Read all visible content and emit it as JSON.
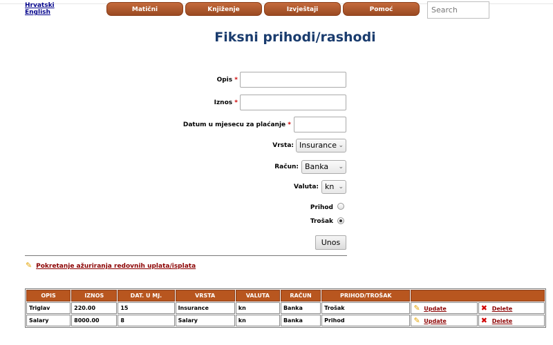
{
  "languages": [
    "Hrvatski",
    "English"
  ],
  "nav": [
    "Matični",
    "Knjiženje",
    "Izvještaji",
    "Pomoć"
  ],
  "search": {
    "placeholder": "Search"
  },
  "title": "Fiksni prihodi/rashodi",
  "form": {
    "opis_label": "Opis",
    "iznos_label": "Iznos",
    "datum_label": "Datum u mjesecu za plaćanje",
    "required_mark": "*",
    "vrsta_label": "Vrsta:",
    "vrsta_value": "Insurance",
    "racun_label": "Račun:",
    "racun_value": "Banka",
    "valuta_label": "Valuta:",
    "valuta_value": "kn",
    "prihod_label": "Prihod",
    "trosak_label": "Trošak",
    "selected_type": "Trošak",
    "submit_label": "Unos"
  },
  "update_link": "Pokretanje ažuriranja redovnih uplata/isplata",
  "table": {
    "headers": [
      "OPIS",
      "IZNOS",
      "DAT. U MJ.",
      "VRSTA",
      "VALUTA",
      "RAČUN",
      "PRIHOD/TROŠAK",
      ""
    ],
    "rows": [
      {
        "opis": "Triglav",
        "iznos": "220.00",
        "dan": "15",
        "vrsta": "Insurance",
        "valuta": "kn",
        "racun": "Banka",
        "tip": "Trošak",
        "update": "Update",
        "delete": "Delete"
      },
      {
        "opis": "Salary",
        "iznos": "8000.00",
        "dan": "8",
        "vrsta": "Salary",
        "valuta": "kn",
        "racun": "Banka",
        "tip": "Prihod",
        "update": "Update",
        "delete": "Delete"
      }
    ]
  },
  "colors": {
    "nav_button": "#b8561f",
    "title": "#1a3c6e",
    "link": "#8b0000",
    "required": "#cc0000"
  }
}
